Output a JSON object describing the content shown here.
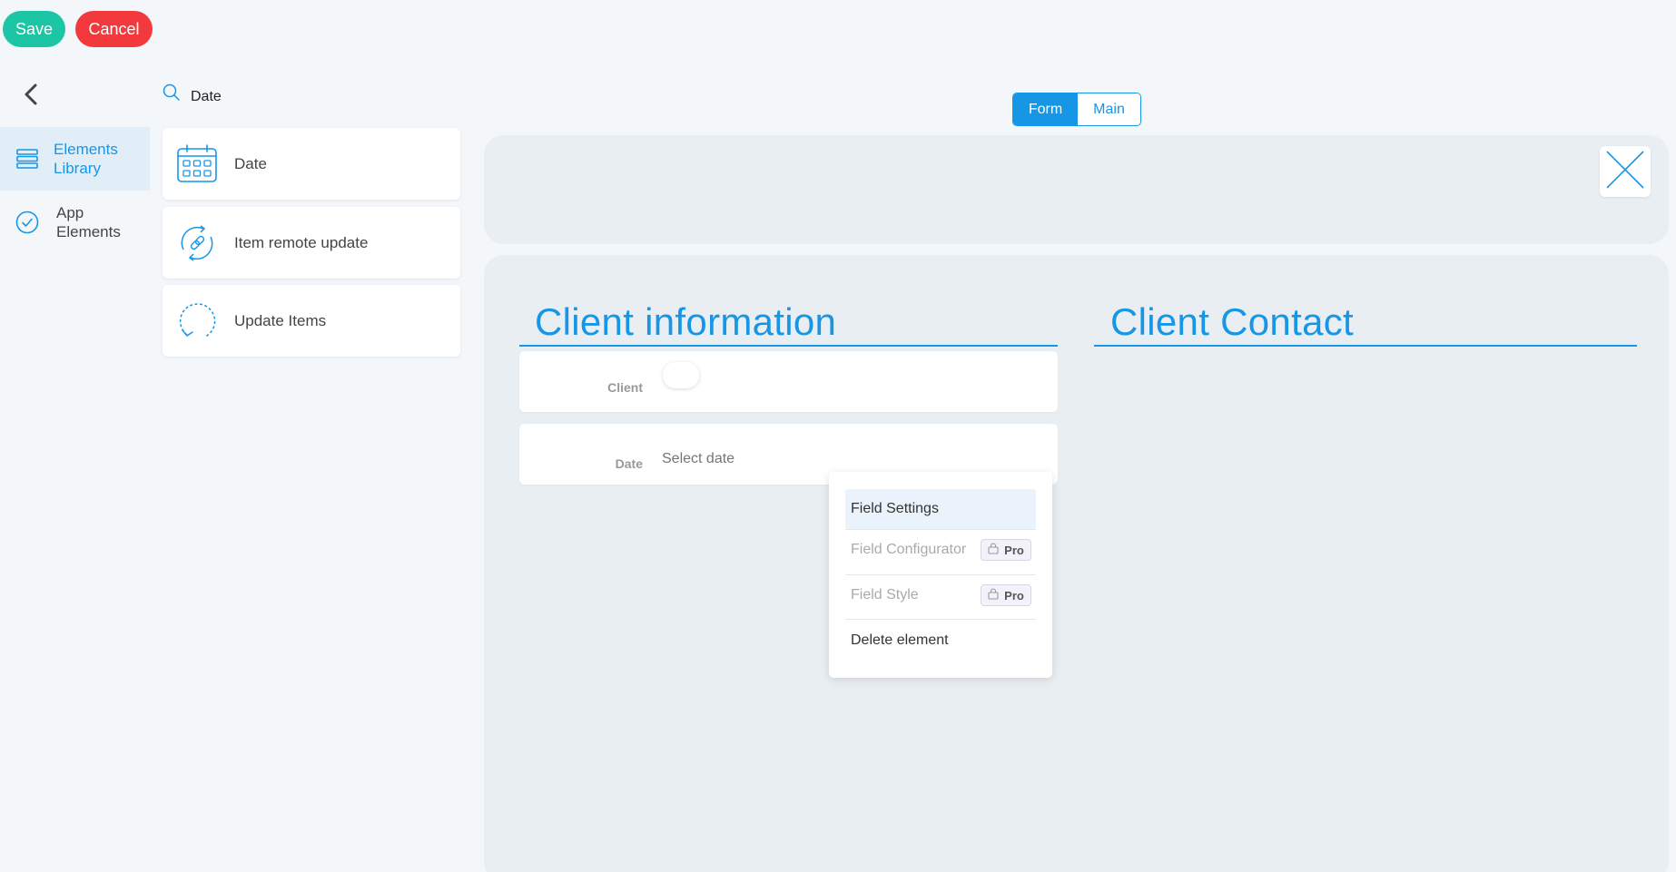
{
  "toolbar": {
    "save_label": "Save",
    "cancel_label": "Cancel"
  },
  "nav": {
    "items": [
      {
        "label": "Elements\nLibrary",
        "icon": "layers-icon",
        "active": true
      },
      {
        "label": "App\nElements",
        "icon": "check-circle-icon",
        "active": false
      }
    ]
  },
  "search": {
    "value": "Date",
    "icon": "search-icon"
  },
  "elements": [
    {
      "label": "Date",
      "icon": "calendar-icon"
    },
    {
      "label": "Item remote update",
      "icon": "link-sync-icon"
    },
    {
      "label": "Update Items",
      "icon": "refresh-icon"
    }
  ],
  "tabs": [
    {
      "label": "Form",
      "active": true
    },
    {
      "label": "Main",
      "active": false
    }
  ],
  "form": {
    "section_left_title": "Client information",
    "section_right_title": "Client Contact",
    "fields": [
      {
        "label": "Client",
        "type": "toggle"
      },
      {
        "label": "Date",
        "type": "date",
        "placeholder": "Select date"
      }
    ]
  },
  "context_menu": {
    "items": [
      {
        "label": "Field Settings",
        "state": "highlighted"
      },
      {
        "label": "Field Configurator",
        "state": "disabled",
        "badge": "Pro"
      },
      {
        "label": "Field Style",
        "state": "disabled",
        "badge": "Pro"
      },
      {
        "label": "Delete element",
        "state": "normal"
      }
    ]
  },
  "colors": {
    "accent": "#1796e6",
    "save": "#1cc6a5",
    "cancel": "#f23a3e",
    "panel": "#e9eef2",
    "background": "#f3f7fa"
  }
}
